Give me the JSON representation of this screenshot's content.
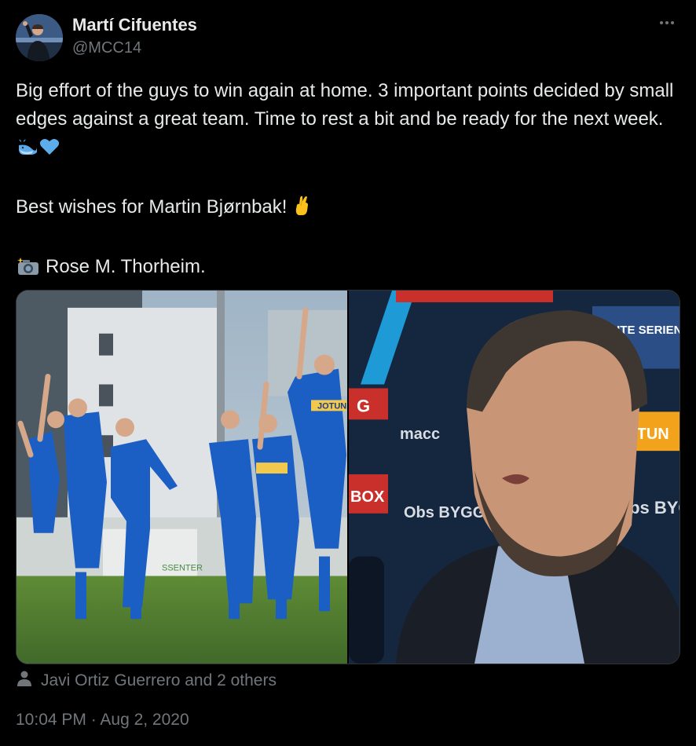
{
  "author": {
    "display_name": "Martí Cifuentes",
    "handle": "@MCC14",
    "avatar_icon": "profile-photo"
  },
  "more_icon": "ellipsis-icon",
  "body": {
    "paragraph_1": "Big effort of the guys to win again at home. 3 important points decided by small edges against a great team. Time to rest a bit and be ready for the next week.",
    "paragraph_1_emojis": [
      "whale-emoji",
      "blue-heart-emoji"
    ],
    "paragraph_2": "Best wishes for Martin Bjørnbak!",
    "paragraph_2_emoji": "crossed-fingers-emoji",
    "paragraph_3": "Rose M. Thorheim.",
    "paragraph_3_emoji": "camera-flash-emoji"
  },
  "media": {
    "left_photo": {
      "subject": "players celebrating on pitch",
      "shirt_sponsor": "JOTUN",
      "banner_text": "SSENTER"
    },
    "right_photo": {
      "subject": "coach speaking to press",
      "backdrop_texts": [
        "ELITE SERIEN",
        "JOTUN",
        "Obs BYGG",
        "Obs BYGG",
        "G",
        "BOX",
        "macc"
      ]
    }
  },
  "likers": {
    "icon": "person-icon",
    "text": "Javi Ortiz Guerrero and 2 others"
  },
  "timestamp": {
    "text": "10:04 PM · Aug 2, 2020"
  },
  "colors": {
    "background": "#000000",
    "primary_text": "#e7e9ea",
    "secondary_text": "#71767b",
    "border": "#2f3336",
    "kit_blue": "#1c5fc4"
  }
}
